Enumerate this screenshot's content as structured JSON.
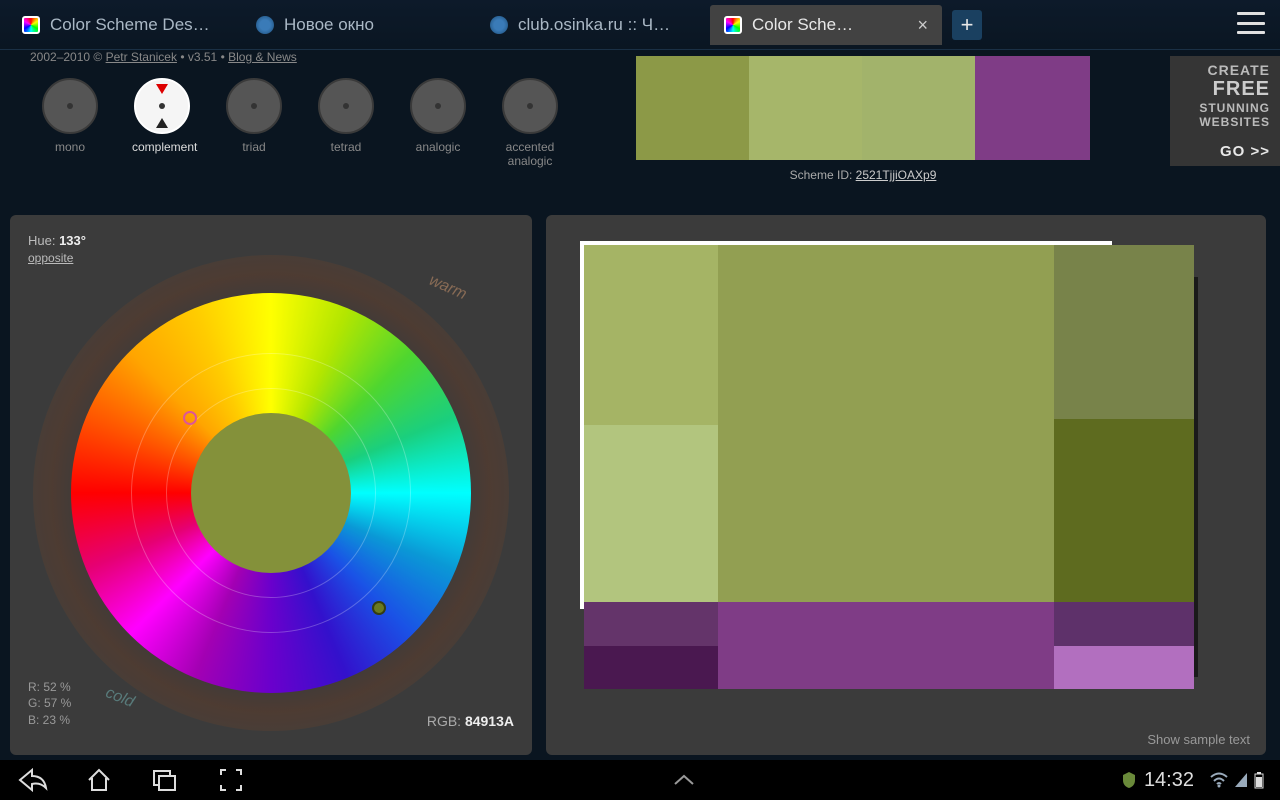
{
  "tabs": [
    {
      "label": "Color Scheme Des…"
    },
    {
      "label": "Новое окно"
    },
    {
      "label": "club.osinka.ru :: Ч…"
    },
    {
      "label": "Color Sche…",
      "active": true
    }
  ],
  "meta": {
    "years": "2002–2010 ©",
    "author": "Petr Stanicek",
    "version": "v3.51",
    "dot": " • ",
    "blog": "Blog & News"
  },
  "schemeTypes": [
    {
      "label": "mono"
    },
    {
      "label": "complement",
      "active": true
    },
    {
      "label": "triad"
    },
    {
      "label": "tetrad"
    },
    {
      "label": "analogic"
    },
    {
      "label": "accented analogic"
    }
  ],
  "schemeId": {
    "prefix": "Scheme ID: ",
    "value": "2521TjjiOAXp9"
  },
  "ad": {
    "l1": "CREATE",
    "l2": "FREE",
    "l3": "STUNNING",
    "l4": "WEBSITES",
    "go": "GO >>"
  },
  "hue": {
    "prefix": "Hue: ",
    "value": "133°",
    "opposite": "opposite"
  },
  "wheel": {
    "warm": "warm",
    "cold": "cold"
  },
  "rgbPercent": {
    "r": "R: 52 %",
    "g": "G: 57 %",
    "b": "B: 23 %"
  },
  "rgb": {
    "prefix": "RGB: ",
    "value": "84913A"
  },
  "sampleText": "Show sample text",
  "navbar": {
    "time": "14:32"
  }
}
